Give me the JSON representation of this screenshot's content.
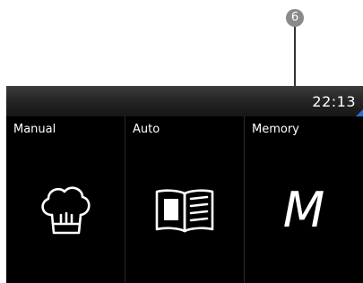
{
  "callout": {
    "number": "6"
  },
  "status_bar": {
    "time": "22:13",
    "accent_color": "#2a6fd6"
  },
  "modes": [
    {
      "label": "Manual",
      "icon": "chef-hat-icon"
    },
    {
      "label": "Auto",
      "icon": "recipe-book-icon"
    },
    {
      "label": "Memory",
      "icon": "memory-m-icon",
      "glyph": "M"
    }
  ]
}
